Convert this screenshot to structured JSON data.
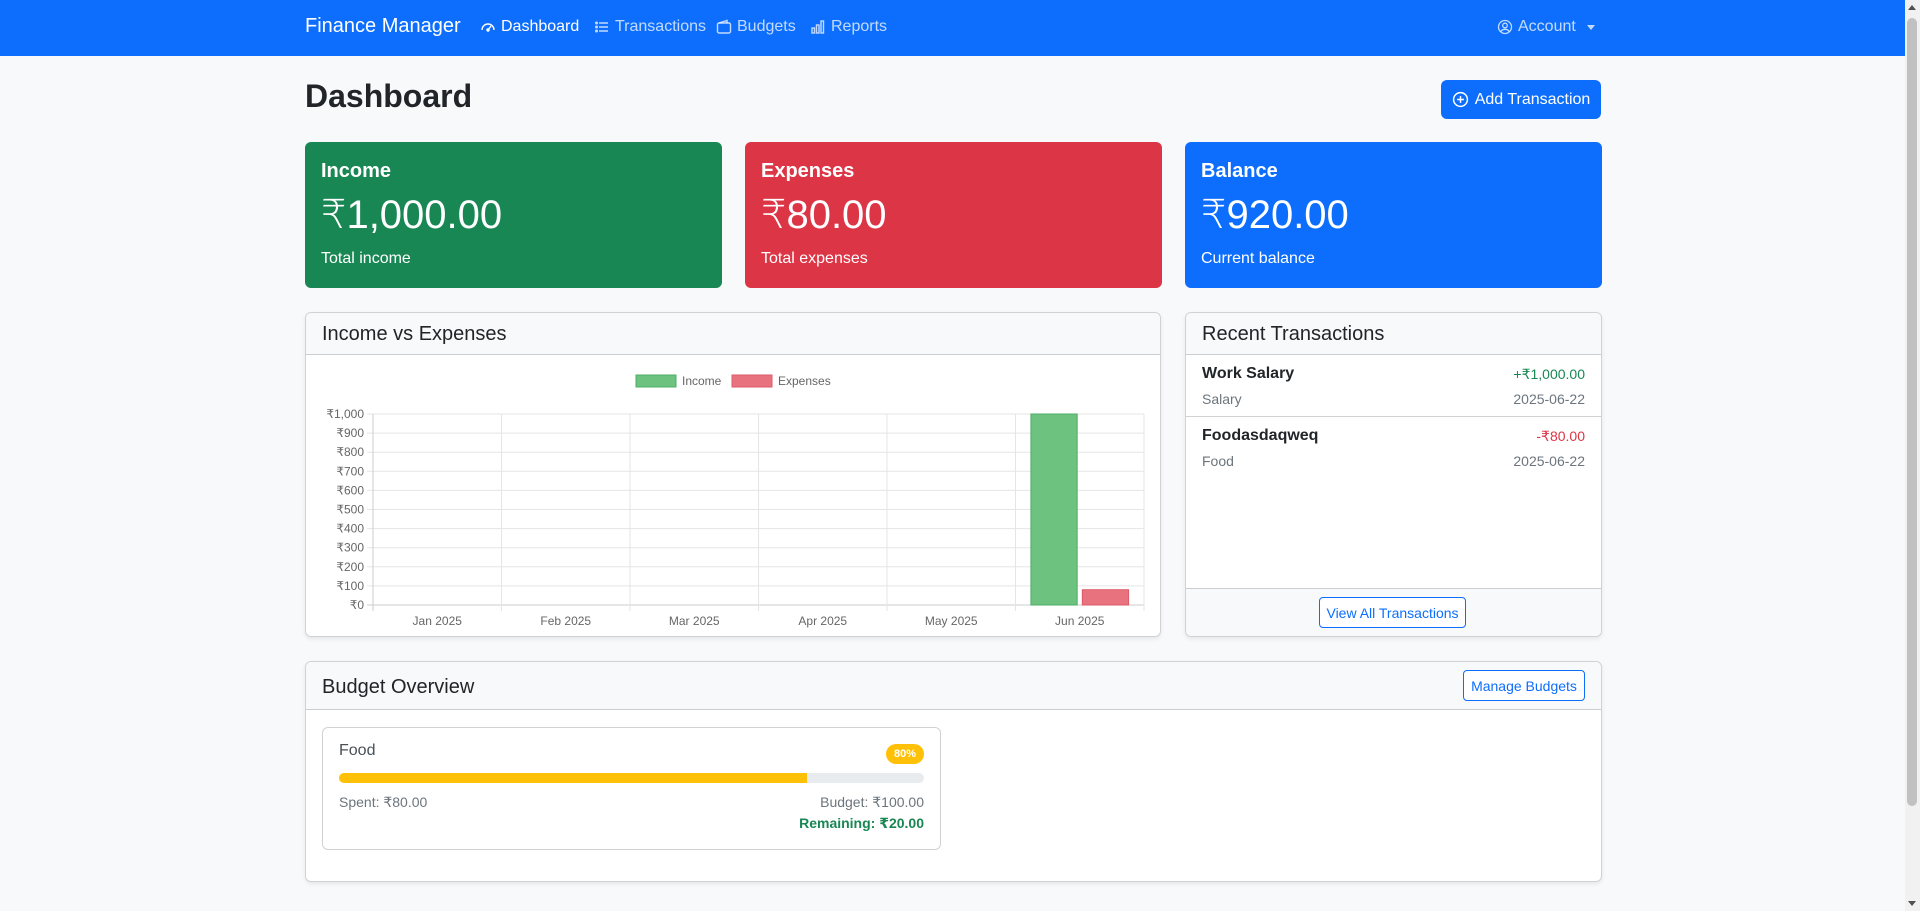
{
  "navbar": {
    "brand": "Finance Manager",
    "items": [
      {
        "label": "Dashboard",
        "icon": "speedometer-icon",
        "active": true
      },
      {
        "label": "Transactions",
        "icon": "list-icon",
        "active": false
      },
      {
        "label": "Budgets",
        "icon": "wallet-icon",
        "active": false
      },
      {
        "label": "Reports",
        "icon": "bar-chart-icon",
        "active": false
      }
    ],
    "account": {
      "label": "Account",
      "icon": "person-circle-icon"
    }
  },
  "header": {
    "title": "Dashboard",
    "add_button": "Add Transaction"
  },
  "summary": {
    "income": {
      "title": "Income",
      "value": "₹1,000.00",
      "text": "Total income",
      "color": "#198754"
    },
    "expenses": {
      "title": "Expenses",
      "value": "₹80.00",
      "text": "Total expenses",
      "color": "#dc3545"
    },
    "balance": {
      "title": "Balance",
      "value": "₹920.00",
      "text": "Current balance",
      "color": "#0d6efd"
    }
  },
  "chart_card": {
    "title": "Income vs Expenses"
  },
  "chart_data": {
    "type": "bar",
    "categories": [
      "Jan 2025",
      "Feb 2025",
      "Mar 2025",
      "Apr 2025",
      "May 2025",
      "Jun 2025"
    ],
    "series": [
      {
        "name": "Income",
        "values": [
          0,
          0,
          0,
          0,
          0,
          1000
        ],
        "color": "#6cc27e"
      },
      {
        "name": "Expenses",
        "values": [
          0,
          0,
          0,
          0,
          0,
          80
        ],
        "color": "#e8737f"
      }
    ],
    "ylim": [
      0,
      1000
    ],
    "yticks": [
      "₹0",
      "₹100",
      "₹200",
      "₹300",
      "₹400",
      "₹500",
      "₹600",
      "₹700",
      "₹800",
      "₹900",
      "₹1,000"
    ],
    "legend": "top",
    "grid": true
  },
  "recent": {
    "title": "Recent Transactions",
    "items": [
      {
        "name": "Work Salary",
        "amount": "+₹1,000.00",
        "category": "Salary",
        "date": "2025-06-22"
      },
      {
        "name": "Foodasdaqweq",
        "amount": "-₹80.00",
        "category": "Food",
        "date": "2025-06-22"
      }
    ],
    "view_all": "View All Transactions"
  },
  "budget": {
    "title": "Budget Overview",
    "manage": "Manage Budgets",
    "items": [
      {
        "name": "Food",
        "percent": "80%",
        "progress": 0.8,
        "spent": "Spent: ₹80.00",
        "budget": "Budget: ₹100.00",
        "remaining": "Remaining: ₹20.00"
      }
    ]
  }
}
